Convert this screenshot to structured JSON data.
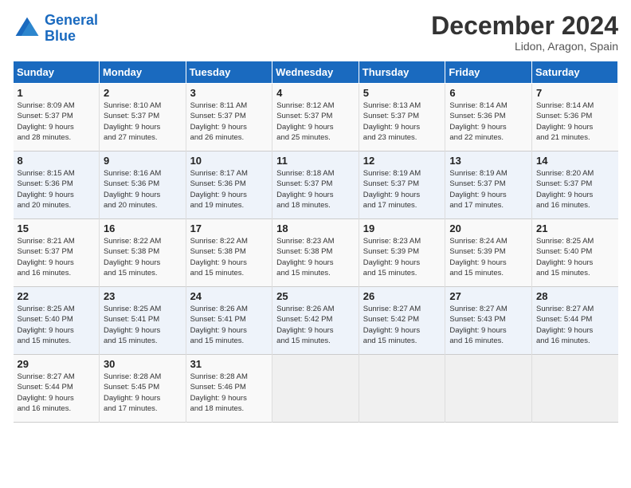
{
  "header": {
    "logo_line1": "General",
    "logo_line2": "Blue",
    "month_title": "December 2024",
    "location": "Lidon, Aragon, Spain"
  },
  "days_of_week": [
    "Sunday",
    "Monday",
    "Tuesday",
    "Wednesday",
    "Thursday",
    "Friday",
    "Saturday"
  ],
  "weeks": [
    [
      {
        "day": 1,
        "lines": [
          "Sunrise: 8:09 AM",
          "Sunset: 5:37 PM",
          "Daylight: 9 hours",
          "and 28 minutes."
        ]
      },
      {
        "day": 2,
        "lines": [
          "Sunrise: 8:10 AM",
          "Sunset: 5:37 PM",
          "Daylight: 9 hours",
          "and 27 minutes."
        ]
      },
      {
        "day": 3,
        "lines": [
          "Sunrise: 8:11 AM",
          "Sunset: 5:37 PM",
          "Daylight: 9 hours",
          "and 26 minutes."
        ]
      },
      {
        "day": 4,
        "lines": [
          "Sunrise: 8:12 AM",
          "Sunset: 5:37 PM",
          "Daylight: 9 hours",
          "and 25 minutes."
        ]
      },
      {
        "day": 5,
        "lines": [
          "Sunrise: 8:13 AM",
          "Sunset: 5:37 PM",
          "Daylight: 9 hours",
          "and 23 minutes."
        ]
      },
      {
        "day": 6,
        "lines": [
          "Sunrise: 8:14 AM",
          "Sunset: 5:36 PM",
          "Daylight: 9 hours",
          "and 22 minutes."
        ]
      },
      {
        "day": 7,
        "lines": [
          "Sunrise: 8:14 AM",
          "Sunset: 5:36 PM",
          "Daylight: 9 hours",
          "and 21 minutes."
        ]
      }
    ],
    [
      {
        "day": 8,
        "lines": [
          "Sunrise: 8:15 AM",
          "Sunset: 5:36 PM",
          "Daylight: 9 hours",
          "and 20 minutes."
        ]
      },
      {
        "day": 9,
        "lines": [
          "Sunrise: 8:16 AM",
          "Sunset: 5:36 PM",
          "Daylight: 9 hours",
          "and 20 minutes."
        ]
      },
      {
        "day": 10,
        "lines": [
          "Sunrise: 8:17 AM",
          "Sunset: 5:36 PM",
          "Daylight: 9 hours",
          "and 19 minutes."
        ]
      },
      {
        "day": 11,
        "lines": [
          "Sunrise: 8:18 AM",
          "Sunset: 5:37 PM",
          "Daylight: 9 hours",
          "and 18 minutes."
        ]
      },
      {
        "day": 12,
        "lines": [
          "Sunrise: 8:19 AM",
          "Sunset: 5:37 PM",
          "Daylight: 9 hours",
          "and 17 minutes."
        ]
      },
      {
        "day": 13,
        "lines": [
          "Sunrise: 8:19 AM",
          "Sunset: 5:37 PM",
          "Daylight: 9 hours",
          "and 17 minutes."
        ]
      },
      {
        "day": 14,
        "lines": [
          "Sunrise: 8:20 AM",
          "Sunset: 5:37 PM",
          "Daylight: 9 hours",
          "and 16 minutes."
        ]
      }
    ],
    [
      {
        "day": 15,
        "lines": [
          "Sunrise: 8:21 AM",
          "Sunset: 5:37 PM",
          "Daylight: 9 hours",
          "and 16 minutes."
        ]
      },
      {
        "day": 16,
        "lines": [
          "Sunrise: 8:22 AM",
          "Sunset: 5:38 PM",
          "Daylight: 9 hours",
          "and 15 minutes."
        ]
      },
      {
        "day": 17,
        "lines": [
          "Sunrise: 8:22 AM",
          "Sunset: 5:38 PM",
          "Daylight: 9 hours",
          "and 15 minutes."
        ]
      },
      {
        "day": 18,
        "lines": [
          "Sunrise: 8:23 AM",
          "Sunset: 5:38 PM",
          "Daylight: 9 hours",
          "and 15 minutes."
        ]
      },
      {
        "day": 19,
        "lines": [
          "Sunrise: 8:23 AM",
          "Sunset: 5:39 PM",
          "Daylight: 9 hours",
          "and 15 minutes."
        ]
      },
      {
        "day": 20,
        "lines": [
          "Sunrise: 8:24 AM",
          "Sunset: 5:39 PM",
          "Daylight: 9 hours",
          "and 15 minutes."
        ]
      },
      {
        "day": 21,
        "lines": [
          "Sunrise: 8:25 AM",
          "Sunset: 5:40 PM",
          "Daylight: 9 hours",
          "and 15 minutes."
        ]
      }
    ],
    [
      {
        "day": 22,
        "lines": [
          "Sunrise: 8:25 AM",
          "Sunset: 5:40 PM",
          "Daylight: 9 hours",
          "and 15 minutes."
        ]
      },
      {
        "day": 23,
        "lines": [
          "Sunrise: 8:25 AM",
          "Sunset: 5:41 PM",
          "Daylight: 9 hours",
          "and 15 minutes."
        ]
      },
      {
        "day": 24,
        "lines": [
          "Sunrise: 8:26 AM",
          "Sunset: 5:41 PM",
          "Daylight: 9 hours",
          "and 15 minutes."
        ]
      },
      {
        "day": 25,
        "lines": [
          "Sunrise: 8:26 AM",
          "Sunset: 5:42 PM",
          "Daylight: 9 hours",
          "and 15 minutes."
        ]
      },
      {
        "day": 26,
        "lines": [
          "Sunrise: 8:27 AM",
          "Sunset: 5:42 PM",
          "Daylight: 9 hours",
          "and 15 minutes."
        ]
      },
      {
        "day": 27,
        "lines": [
          "Sunrise: 8:27 AM",
          "Sunset: 5:43 PM",
          "Daylight: 9 hours",
          "and 16 minutes."
        ]
      },
      {
        "day": 28,
        "lines": [
          "Sunrise: 8:27 AM",
          "Sunset: 5:44 PM",
          "Daylight: 9 hours",
          "and 16 minutes."
        ]
      }
    ],
    [
      {
        "day": 29,
        "lines": [
          "Sunrise: 8:27 AM",
          "Sunset: 5:44 PM",
          "Daylight: 9 hours",
          "and 16 minutes."
        ]
      },
      {
        "day": 30,
        "lines": [
          "Sunrise: 8:28 AM",
          "Sunset: 5:45 PM",
          "Daylight: 9 hours",
          "and 17 minutes."
        ]
      },
      {
        "day": 31,
        "lines": [
          "Sunrise: 8:28 AM",
          "Sunset: 5:46 PM",
          "Daylight: 9 hours",
          "and 18 minutes."
        ]
      },
      null,
      null,
      null,
      null
    ]
  ]
}
